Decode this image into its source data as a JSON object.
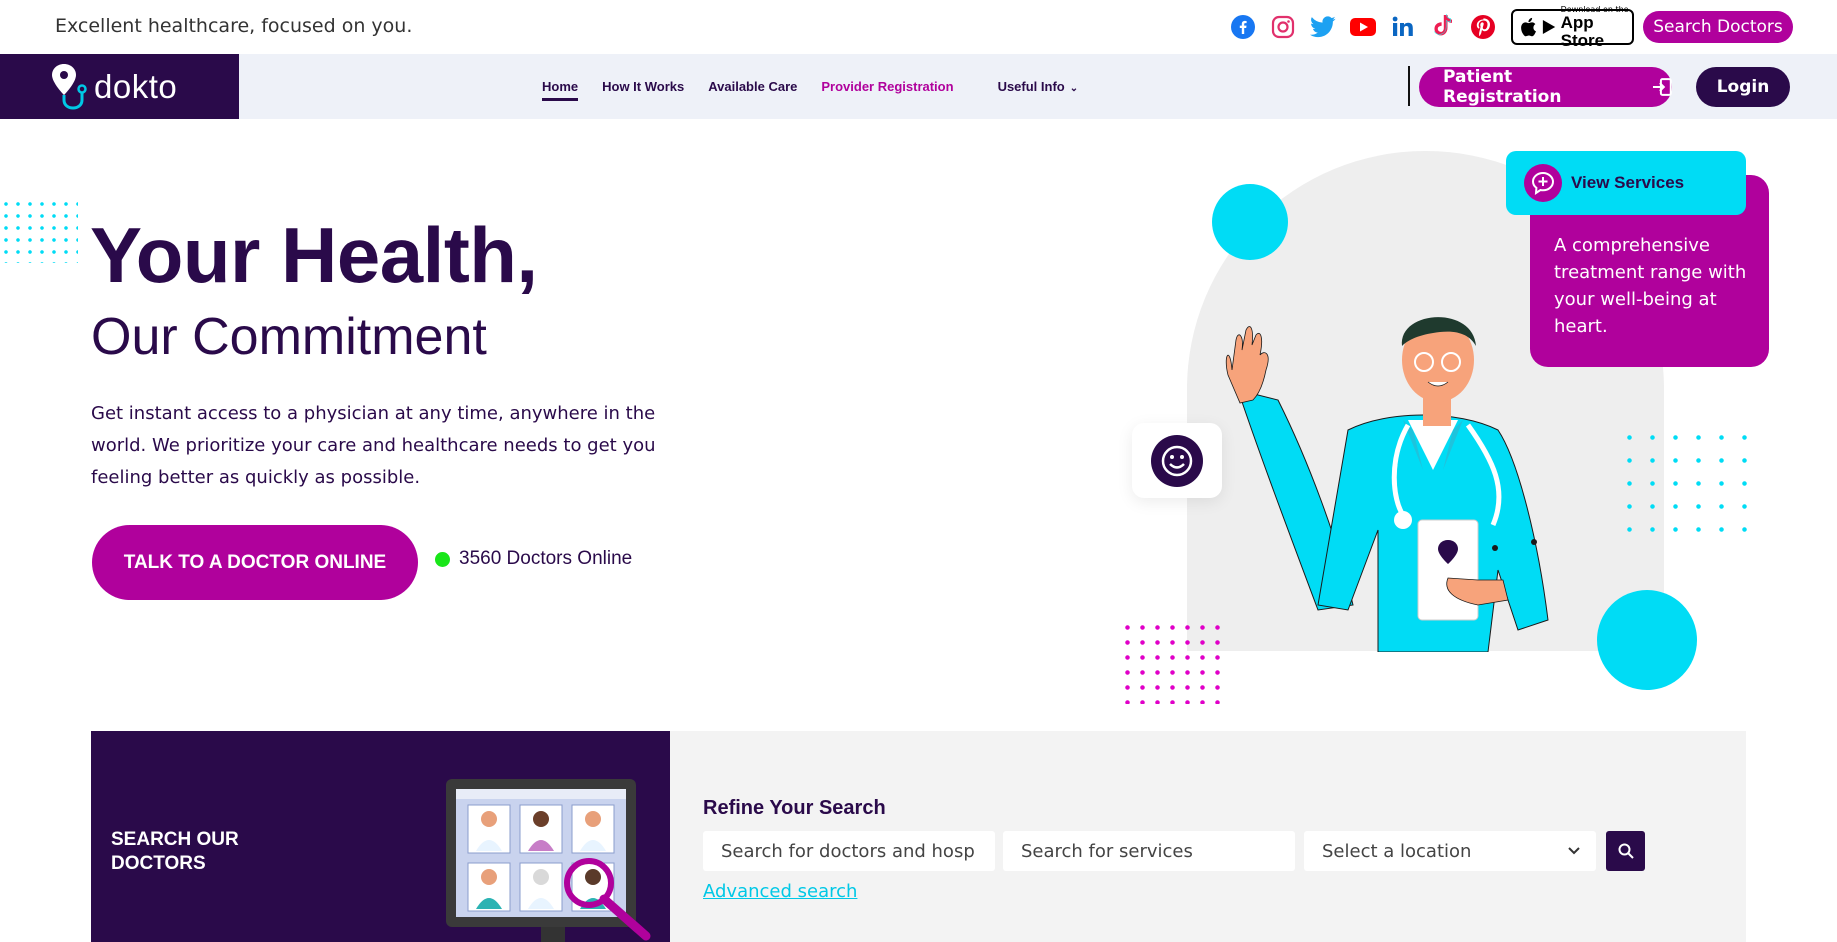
{
  "topbar": {
    "tagline": "Excellent healthcare, focused on you.",
    "socials": [
      "facebook-icon",
      "instagram-icon",
      "twitter-icon",
      "youtube-icon",
      "linkedin-icon",
      "tiktok-icon",
      "pinterest-icon"
    ],
    "app_store_small": "Download on the",
    "app_store_big": "App Store",
    "search_doctors": "Search Doctors"
  },
  "nav": {
    "logo": "dokto",
    "links": [
      "Home",
      "How It Works",
      "Available Care",
      "Provider Registration",
      "Useful Info"
    ],
    "patient_registration": "Patient Registration",
    "login": "Login"
  },
  "hero": {
    "title": "Your Health,",
    "subtitle": "Our Commitment",
    "description": "Get instant access to a physician at any time, anywhere in the world. We prioritize your care and healthcare needs to get you feeling better as quickly as possible.",
    "cta": "TALK TO A DOCTOR ONLINE",
    "online_count": "3560 Doctors Online"
  },
  "services": {
    "button": "View Services",
    "text": "A comprehensive treatment range with your well-being at heart."
  },
  "search": {
    "section_title_line1": "SEARCH OUR",
    "section_title_line2": "DOCTORS",
    "refine_title": "Refine Your Search",
    "doctor_placeholder": "Search for doctors and hosp",
    "services_placeholder": "Search for services",
    "location_placeholder": "Select a location",
    "advanced": "Advanced search"
  },
  "colors": {
    "brand_dark": "#2a0a4a",
    "brand_magenta": "#b0019c",
    "accent_cyan": "#00dcf5",
    "online_green": "#19e619"
  }
}
